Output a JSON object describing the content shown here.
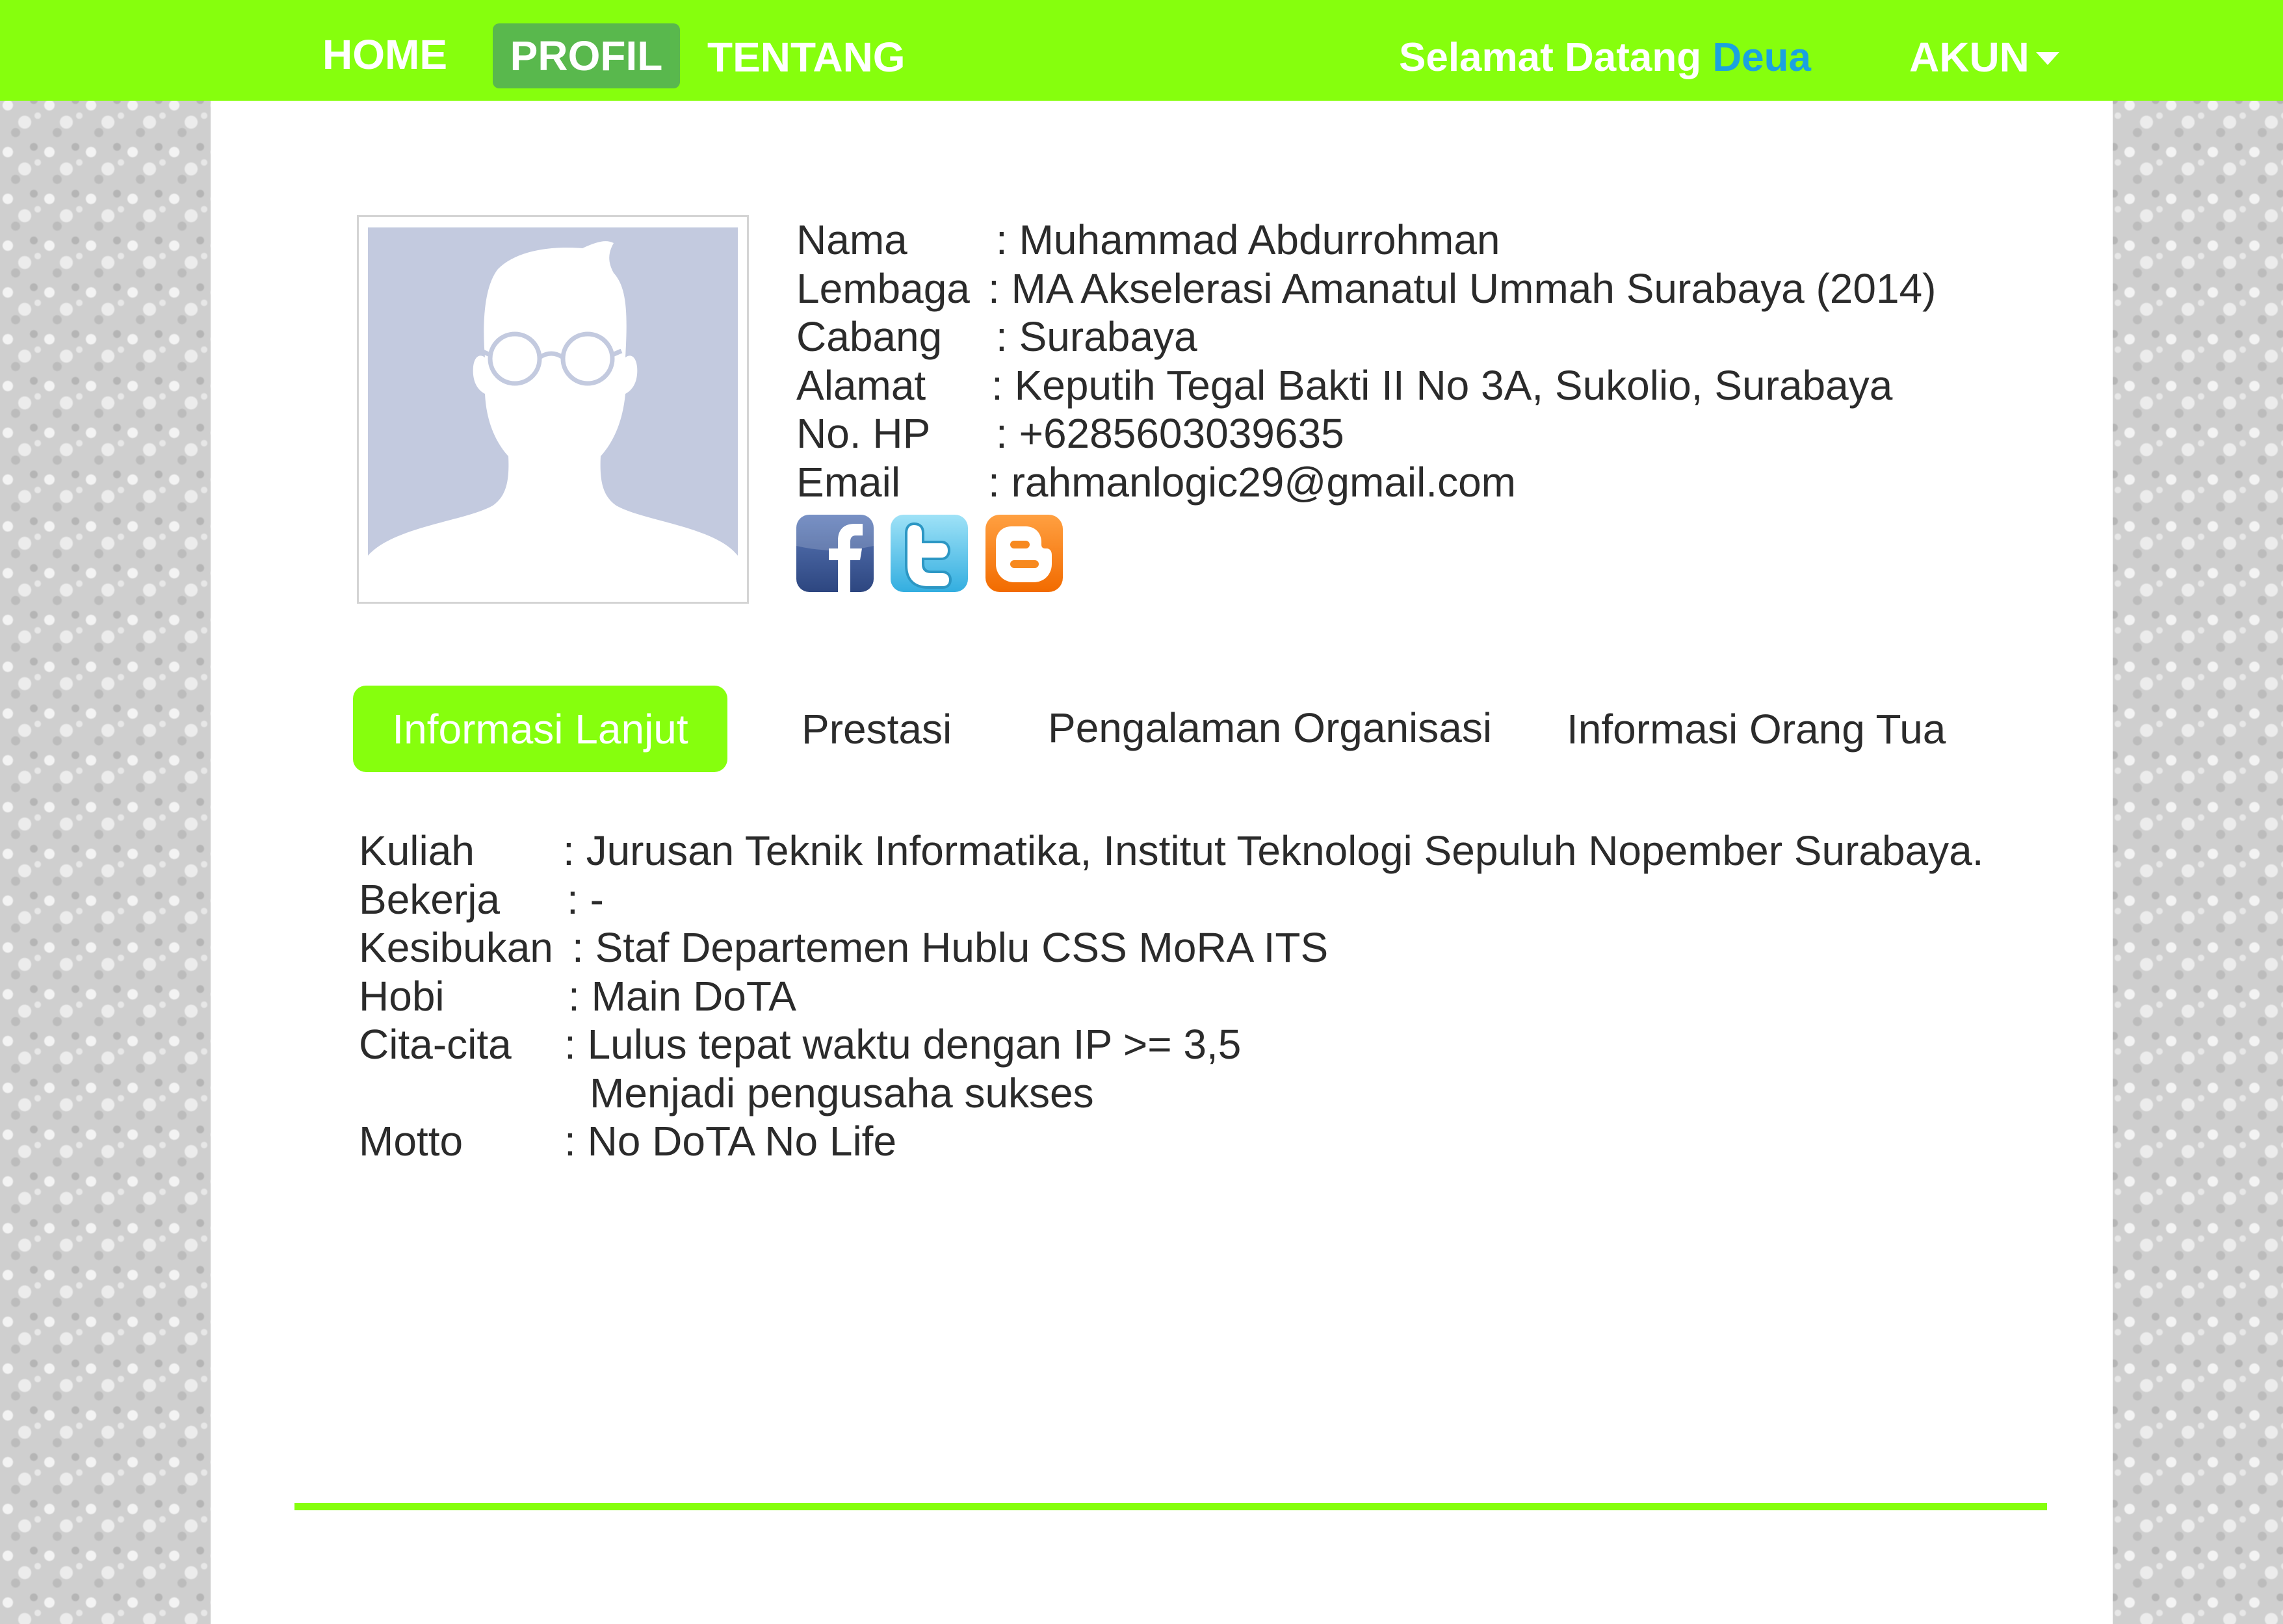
{
  "nav": {
    "home": "HOME",
    "profil": "PROFIL",
    "tentang": "TENTANG",
    "welcome_prefix": "Selamat Datang",
    "username": "Deua",
    "account": "AKUN"
  },
  "profile": {
    "rows": [
      {
        "label": "Nama",
        "value": ": Muhammad Abdurrohman"
      },
      {
        "label": "Lembaga",
        "value": ": MA Akselerasi Amanatul Ummah Surabaya (2014)"
      },
      {
        "label": "Cabang",
        "value": ": Surabaya"
      },
      {
        "label": "Alamat",
        "value": ": Keputih Tegal Bakti II No 3A, Sukolio, Surabaya"
      },
      {
        "label": "No. HP",
        "value": ": +6285603039635"
      },
      {
        "label": "Email",
        "value": ": rahmanlogic29@gmail.com"
      }
    ],
    "social": [
      "facebook-icon",
      "twitter-icon",
      "blogger-icon"
    ]
  },
  "tabs": [
    "Informasi Lanjut",
    "Prestasi",
    "Pengalaman Organisasi",
    "Informasi Orang Tua"
  ],
  "details": {
    "rows": [
      {
        "label": "Kuliah",
        "value": ": Jurusan Teknik Informatika, Institut Teknologi Sepuluh Nopember Surabaya."
      },
      {
        "label": "Bekerja",
        "value": ": -"
      },
      {
        "label": "Kesibukan",
        "value": ": Staf Departemen Hublu CSS MoRA ITS"
      },
      {
        "label": "Hobi",
        "value": ": Main DoTA"
      },
      {
        "label": "Cita-cita",
        "value": ": Lulus tepat waktu dengan IP >= 3,5"
      },
      {
        "label": "",
        "value": "Menjadi pengusaha sukses"
      },
      {
        "label": "Motto",
        "value": ": No DoTA No Life"
      }
    ]
  },
  "colors": {
    "accent_green": "#86ff0d",
    "active_nav_green": "#59b84d",
    "username_blue": "#1ba2e0"
  }
}
